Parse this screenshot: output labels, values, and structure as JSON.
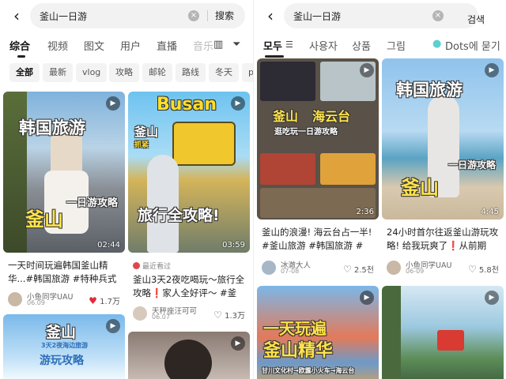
{
  "left": {
    "search": {
      "back": "‹",
      "query": "釜山一日游",
      "clear": "×",
      "button": "搜索"
    },
    "tabs": [
      "综合",
      "视频",
      "图文",
      "用户",
      "直播",
      "音乐"
    ],
    "tab_icons": {
      "layout": "layout-icon",
      "filter": "filter-icon"
    },
    "chips": [
      "全部",
      "最新",
      "vlog",
      "攻略",
      "邮轮",
      "路线",
      "冬天",
      "p"
    ],
    "cards": [
      {
        "overlay": [
          "韩国旅游",
          "釜山",
          "一日游攻略"
        ],
        "duration": "02:44",
        "title": "一天时间玩遍韩国釜山精华...#韩国旅游 #特种兵式旅游...",
        "user": "小鱼同学UAU",
        "date": "06.09",
        "likes": "1.7万"
      },
      {
        "overlay": [
          "Busan",
          "釜山",
          "抓紧",
          "旅行全攻略!"
        ],
        "duration": "03:59",
        "badge": "最近看过",
        "title": "釜山3天2夜吃喝玩～旅行全攻略❗家人全好评～ #釜山 #...",
        "user": "天秤座汪可可",
        "date": "06.07",
        "likes": "1.3万"
      },
      {
        "overlay": [
          "釜山",
          "3天2夜海边旅游",
          "游玩攻略"
        ]
      },
      {
        "overlay": []
      }
    ]
  },
  "right": {
    "search": {
      "back": "‹",
      "query": "釜山一日游",
      "clear": "×",
      "button": "검색"
    },
    "tabs": [
      "모두",
      "사용자",
      "상품",
      "그림",
      "Dots에 묻기"
    ],
    "cards": [
      {
        "overlay": [
          "釜山",
          "海云台",
          "逛吃玩一日游攻略"
        ],
        "duration": "2:36",
        "title": "釜山的浪漫! 海云台占一半! #釜山旅游 #韩国旅游 #韩...",
        "user": "冰澈大人",
        "date": "07-08",
        "likes": "2.5천"
      },
      {
        "overlay": [
          "韩国旅游",
          "一日游攻略",
          "釜山"
        ],
        "duration": "4:45",
        "title": "24小时首尔往返釜山游玩攻略! 给我玩爽了❗从前期交...",
        "user": "小鱼同学UAU",
        "date": "06-09",
        "likes": "5.8천"
      },
      {
        "overlay": [
          "一天玩遍",
          "釜山精华",
          "甘川文化村→欧露小火车→海云台"
        ]
      },
      {
        "overlay": []
      }
    ]
  },
  "colors": {
    "accent": "#e02b3b",
    "chip_bg": "#f3f3f3",
    "search_bg": "#f2f2f2"
  }
}
